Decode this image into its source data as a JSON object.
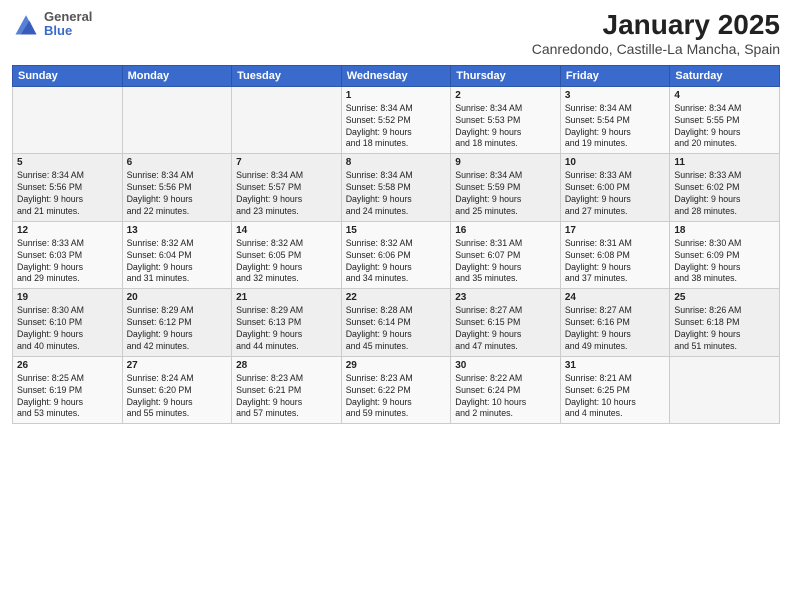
{
  "logo": {
    "general": "General",
    "blue": "Blue"
  },
  "title": "January 2025",
  "subtitle": "Canredondo, Castille-La Mancha, Spain",
  "days_of_week": [
    "Sunday",
    "Monday",
    "Tuesday",
    "Wednesday",
    "Thursday",
    "Friday",
    "Saturday"
  ],
  "weeks": [
    [
      {
        "day": "",
        "content": ""
      },
      {
        "day": "",
        "content": ""
      },
      {
        "day": "",
        "content": ""
      },
      {
        "day": "1",
        "content": "Sunrise: 8:34 AM\nSunset: 5:52 PM\nDaylight: 9 hours\nand 18 minutes."
      },
      {
        "day": "2",
        "content": "Sunrise: 8:34 AM\nSunset: 5:53 PM\nDaylight: 9 hours\nand 18 minutes."
      },
      {
        "day": "3",
        "content": "Sunrise: 8:34 AM\nSunset: 5:54 PM\nDaylight: 9 hours\nand 19 minutes."
      },
      {
        "day": "4",
        "content": "Sunrise: 8:34 AM\nSunset: 5:55 PM\nDaylight: 9 hours\nand 20 minutes."
      }
    ],
    [
      {
        "day": "5",
        "content": "Sunrise: 8:34 AM\nSunset: 5:56 PM\nDaylight: 9 hours\nand 21 minutes."
      },
      {
        "day": "6",
        "content": "Sunrise: 8:34 AM\nSunset: 5:56 PM\nDaylight: 9 hours\nand 22 minutes."
      },
      {
        "day": "7",
        "content": "Sunrise: 8:34 AM\nSunset: 5:57 PM\nDaylight: 9 hours\nand 23 minutes."
      },
      {
        "day": "8",
        "content": "Sunrise: 8:34 AM\nSunset: 5:58 PM\nDaylight: 9 hours\nand 24 minutes."
      },
      {
        "day": "9",
        "content": "Sunrise: 8:34 AM\nSunset: 5:59 PM\nDaylight: 9 hours\nand 25 minutes."
      },
      {
        "day": "10",
        "content": "Sunrise: 8:33 AM\nSunset: 6:00 PM\nDaylight: 9 hours\nand 27 minutes."
      },
      {
        "day": "11",
        "content": "Sunrise: 8:33 AM\nSunset: 6:02 PM\nDaylight: 9 hours\nand 28 minutes."
      }
    ],
    [
      {
        "day": "12",
        "content": "Sunrise: 8:33 AM\nSunset: 6:03 PM\nDaylight: 9 hours\nand 29 minutes."
      },
      {
        "day": "13",
        "content": "Sunrise: 8:32 AM\nSunset: 6:04 PM\nDaylight: 9 hours\nand 31 minutes."
      },
      {
        "day": "14",
        "content": "Sunrise: 8:32 AM\nSunset: 6:05 PM\nDaylight: 9 hours\nand 32 minutes."
      },
      {
        "day": "15",
        "content": "Sunrise: 8:32 AM\nSunset: 6:06 PM\nDaylight: 9 hours\nand 34 minutes."
      },
      {
        "day": "16",
        "content": "Sunrise: 8:31 AM\nSunset: 6:07 PM\nDaylight: 9 hours\nand 35 minutes."
      },
      {
        "day": "17",
        "content": "Sunrise: 8:31 AM\nSunset: 6:08 PM\nDaylight: 9 hours\nand 37 minutes."
      },
      {
        "day": "18",
        "content": "Sunrise: 8:30 AM\nSunset: 6:09 PM\nDaylight: 9 hours\nand 38 minutes."
      }
    ],
    [
      {
        "day": "19",
        "content": "Sunrise: 8:30 AM\nSunset: 6:10 PM\nDaylight: 9 hours\nand 40 minutes."
      },
      {
        "day": "20",
        "content": "Sunrise: 8:29 AM\nSunset: 6:12 PM\nDaylight: 9 hours\nand 42 minutes."
      },
      {
        "day": "21",
        "content": "Sunrise: 8:29 AM\nSunset: 6:13 PM\nDaylight: 9 hours\nand 44 minutes."
      },
      {
        "day": "22",
        "content": "Sunrise: 8:28 AM\nSunset: 6:14 PM\nDaylight: 9 hours\nand 45 minutes."
      },
      {
        "day": "23",
        "content": "Sunrise: 8:27 AM\nSunset: 6:15 PM\nDaylight: 9 hours\nand 47 minutes."
      },
      {
        "day": "24",
        "content": "Sunrise: 8:27 AM\nSunset: 6:16 PM\nDaylight: 9 hours\nand 49 minutes."
      },
      {
        "day": "25",
        "content": "Sunrise: 8:26 AM\nSunset: 6:18 PM\nDaylight: 9 hours\nand 51 minutes."
      }
    ],
    [
      {
        "day": "26",
        "content": "Sunrise: 8:25 AM\nSunset: 6:19 PM\nDaylight: 9 hours\nand 53 minutes."
      },
      {
        "day": "27",
        "content": "Sunrise: 8:24 AM\nSunset: 6:20 PM\nDaylight: 9 hours\nand 55 minutes."
      },
      {
        "day": "28",
        "content": "Sunrise: 8:23 AM\nSunset: 6:21 PM\nDaylight: 9 hours\nand 57 minutes."
      },
      {
        "day": "29",
        "content": "Sunrise: 8:23 AM\nSunset: 6:22 PM\nDaylight: 9 hours\nand 59 minutes."
      },
      {
        "day": "30",
        "content": "Sunrise: 8:22 AM\nSunset: 6:24 PM\nDaylight: 10 hours\nand 2 minutes."
      },
      {
        "day": "31",
        "content": "Sunrise: 8:21 AM\nSunset: 6:25 PM\nDaylight: 10 hours\nand 4 minutes."
      },
      {
        "day": "",
        "content": ""
      }
    ]
  ]
}
